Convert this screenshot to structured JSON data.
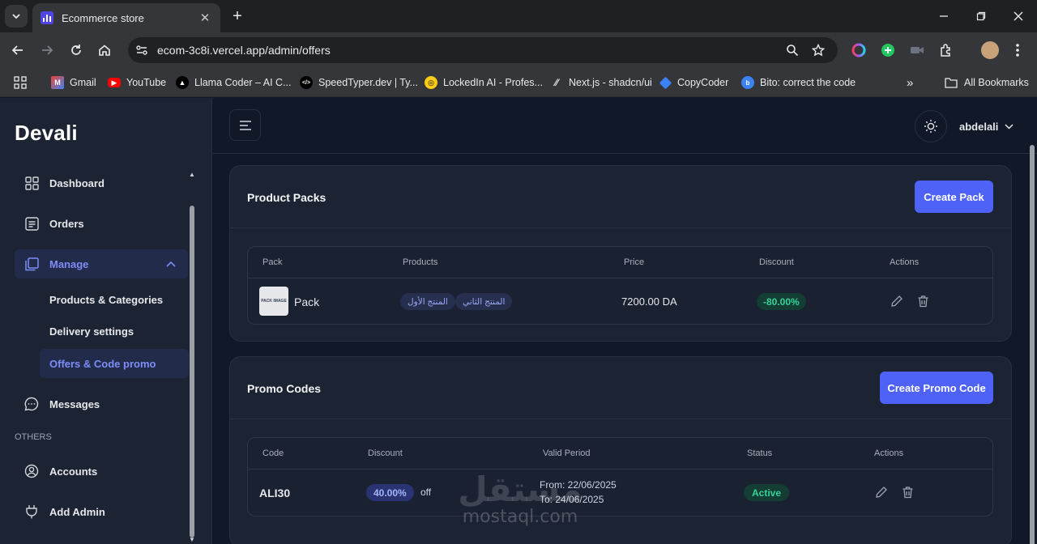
{
  "browser": {
    "tab_title": "Ecommerce store",
    "url": "ecom-3c8i.vercel.app/admin/offers",
    "bookmarks": [
      {
        "label": "Gmail"
      },
      {
        "label": "YouTube"
      },
      {
        "label": "Llama Coder – AI C..."
      },
      {
        "label": "SpeedTyper.dev | Ty..."
      },
      {
        "label": "LockedIn AI - Profes..."
      },
      {
        "label": "Next.js - shadcn/ui"
      },
      {
        "label": "CopyCoder"
      },
      {
        "label": "Bito: correct the code"
      }
    ],
    "all_bookmarks": "All Bookmarks",
    "overflow": "»"
  },
  "sidebar": {
    "logo": "Devali",
    "dashboard": "Dashboard",
    "orders": "Orders",
    "manage": "Manage",
    "sub_items": [
      "Products & Categories",
      "Delivery settings",
      "Offers & Code promo"
    ],
    "messages": "Messages",
    "others_label": "OTHERS",
    "accounts": "Accounts",
    "add_admin": "Add Admin"
  },
  "header": {
    "user": "abdelali"
  },
  "packs": {
    "title": "Product Packs",
    "create_label": "Create Pack",
    "columns": [
      "Pack",
      "Products",
      "Price",
      "Discount",
      "Actions"
    ],
    "rows": [
      {
        "image_text": "PACK IMAGE",
        "name": "Pack",
        "products": [
          "المنتج الثاني",
          "المنتج الأول"
        ],
        "price": "7200.00 DA",
        "discount": "-80.00%"
      }
    ]
  },
  "promo": {
    "title": "Promo Codes",
    "create_label": "Create Promo Code",
    "columns": [
      "Code",
      "Discount",
      "Valid Period",
      "Status",
      "Actions"
    ],
    "rows": [
      {
        "code": "ALI30",
        "discount": "40.00%",
        "discount_suffix": "off",
        "from": "From: 22/06/2025",
        "to": "To: 24/06/2025",
        "status": "Active"
      }
    ]
  },
  "watermark": {
    "arabic": "مستقل",
    "latin": "mostaql.com"
  },
  "colors": {
    "accent": "#4f62f7",
    "active_nav": "#7e8cf7",
    "success": "#34d399",
    "background": "#111827",
    "panel": "#1c2433"
  }
}
